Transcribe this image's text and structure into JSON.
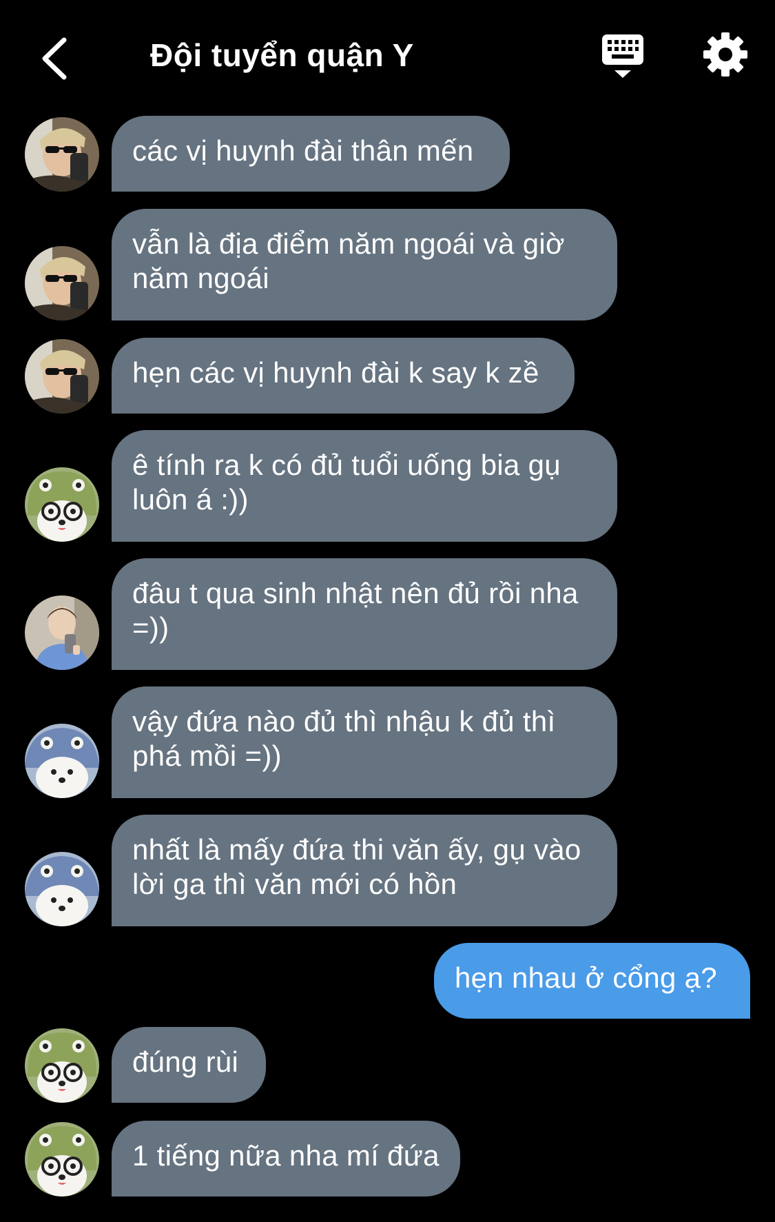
{
  "header": {
    "title": "Đội tuyển quận Y",
    "back_icon": "chevron-left-icon",
    "keyboard_icon": "keyboard-icon",
    "settings_icon": "gear-icon"
  },
  "colors": {
    "background": "#000000",
    "incoming_bubble": "#667380",
    "outgoing_bubble": "#4a9be8",
    "text": "#ffffff"
  },
  "messages": [
    {
      "sender": "avatar-sunglasses",
      "direction": "incoming",
      "text": "các vị huynh đài thân mến"
    },
    {
      "sender": "avatar-sunglasses",
      "direction": "incoming",
      "text": "vẫn là địa điểm năm ngoái và giờ năm ngoái"
    },
    {
      "sender": "avatar-sunglasses",
      "direction": "incoming",
      "text": "hẹn các vị huynh đài k say k zề"
    },
    {
      "sender": "avatar-dog-green-hat",
      "direction": "incoming",
      "text": "ê tính ra k có đủ tuổi uống bia gụ luôn á :))"
    },
    {
      "sender": "avatar-mirror-selfie",
      "direction": "incoming",
      "text": "đâu t qua sinh nhật nên đủ rồi nha =))"
    },
    {
      "sender": "avatar-dog-blue-hat",
      "direction": "incoming",
      "text": "vậy đứa nào đủ thì nhậu k đủ thì phá mồi =))"
    },
    {
      "sender": "avatar-dog-blue-hat",
      "direction": "incoming",
      "text": "nhất là mấy đứa thi văn ấy, gụ vào lời ga thì văn mới có hồn"
    },
    {
      "sender": "me",
      "direction": "outgoing",
      "text": "hẹn nhau ở cổng ạ?"
    },
    {
      "sender": "avatar-dog-green-hat",
      "direction": "incoming",
      "text": "đúng rùi"
    },
    {
      "sender": "avatar-dog-green-hat",
      "direction": "incoming",
      "text": "1 tiếng nữa nha mí đứa"
    }
  ]
}
